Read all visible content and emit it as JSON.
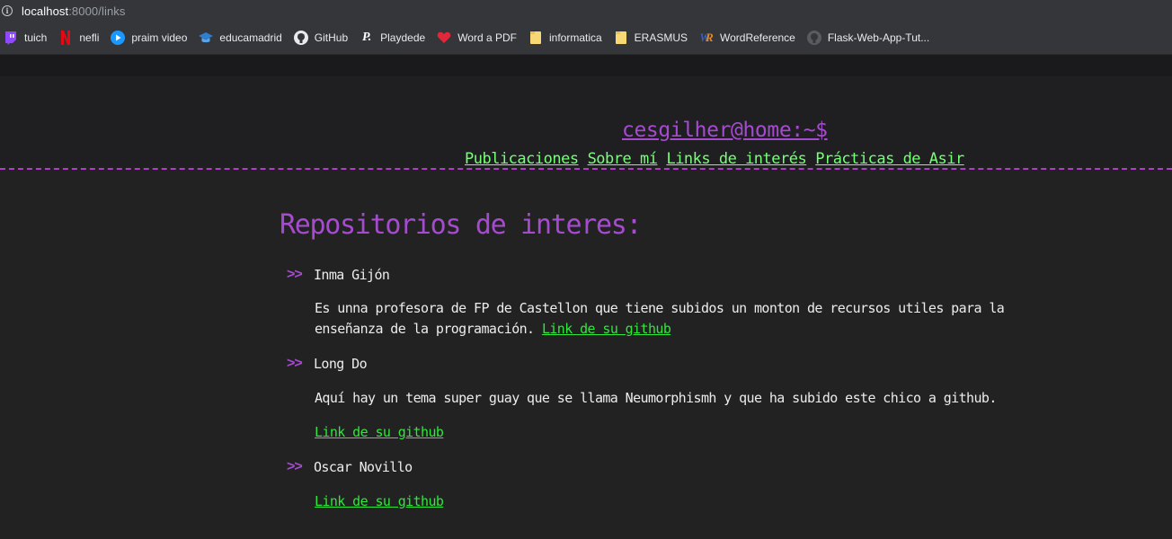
{
  "browser": {
    "url_host": "localhost",
    "url_path": ":8000/links",
    "bookmarks": [
      {
        "label": "tuich",
        "icon": "twitch-icon"
      },
      {
        "label": "nefli",
        "icon": "netflix-icon"
      },
      {
        "label": "praim video",
        "icon": "prime-video-icon"
      },
      {
        "label": "educamadrid",
        "icon": "educamadrid-icon"
      },
      {
        "label": "GitHub",
        "icon": "github-icon"
      },
      {
        "label": "Playdede",
        "icon": "playdede-icon"
      },
      {
        "label": "Word a PDF",
        "icon": "heart-icon"
      },
      {
        "label": "informatica",
        "icon": "folder-icon"
      },
      {
        "label": "ERASMUS",
        "icon": "folder-icon"
      },
      {
        "label": "WordReference",
        "icon": "wordreference-icon"
      },
      {
        "label": "Flask-Web-App-Tut...",
        "icon": "github-icon"
      }
    ],
    "colors": {
      "chrome": "#35363a",
      "folder": "#f8d775"
    }
  },
  "site": {
    "title": "cesgilher@home:~$",
    "nav": [
      "Publicaciones",
      "Sobre mí",
      "Links de interés",
      "Prácticas de Asir"
    ]
  },
  "main": {
    "section_title": "Repositorios de interes:",
    "marker": ">>",
    "items": [
      {
        "name": "Inma Gijón",
        "desc_line1": "Es unna profesora de FP de Castellon que tiene subidos un monton de recursos utiles para la",
        "desc_line2": "enseñanza de la programación.",
        "link": "Link de su github"
      },
      {
        "name": "Long Do",
        "desc": "Aquí hay un tema super guay que se llama Neumorphismh y que ha subido este chico a github.",
        "link": "Link de su github"
      },
      {
        "name": "Oscar Novillo",
        "link": "Link de su github"
      }
    ],
    "colors": {
      "accent": "#a64bd0",
      "nav_link": "#78ff78",
      "github_link": "#2ee83a"
    }
  }
}
